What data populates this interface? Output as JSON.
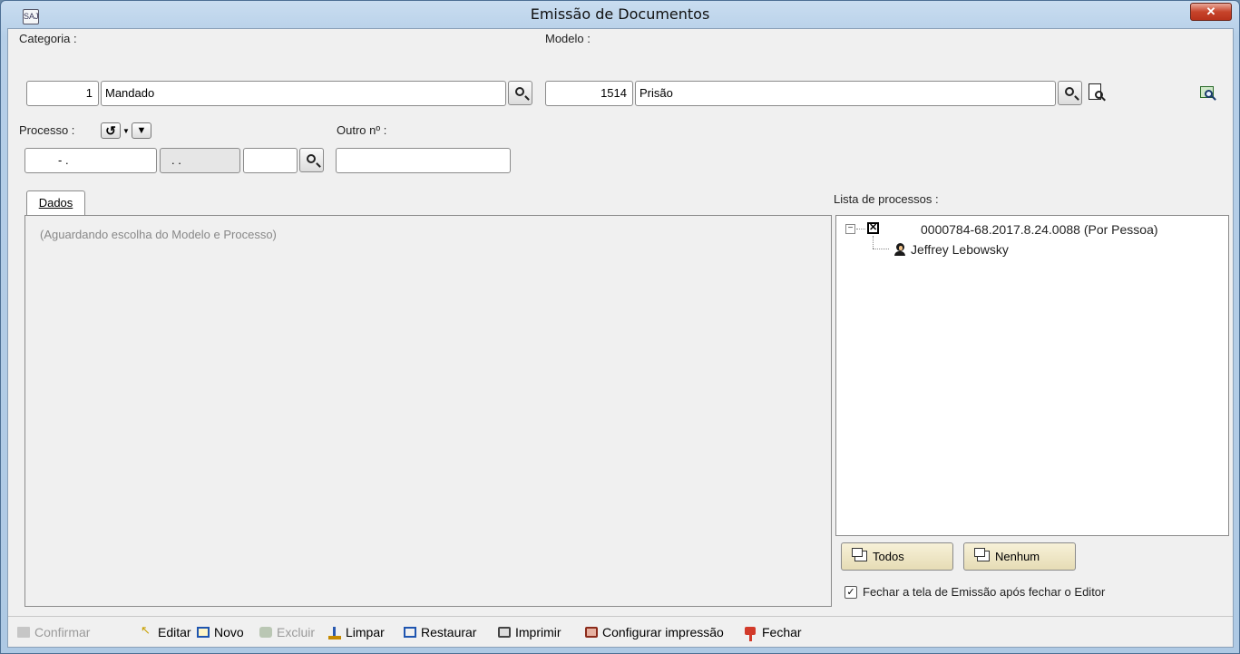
{
  "window": {
    "title": "Emissão de Documentos",
    "app_icon_text": "SAJ",
    "close_label": "✕"
  },
  "categoria": {
    "label": "Categoria :",
    "code": "1",
    "name": "Mandado"
  },
  "modelo": {
    "label": "Modelo :",
    "code": "1514",
    "name": "Prisão"
  },
  "processo": {
    "label": "Processo :",
    "part1": "- .",
    "part2": ". .",
    "part3": ""
  },
  "outro": {
    "label": "Outro nº :",
    "value": ""
  },
  "tabs": [
    {
      "label": "Dados"
    }
  ],
  "dados": {
    "placeholder": "(Aguardando escolha do Modelo e Processo)"
  },
  "lista": {
    "label": "Lista de processos :",
    "items": [
      {
        "text": "0000784-68.2017.8.24.0088 (Por Pessoa)",
        "checked": true,
        "children": [
          {
            "text": "Jeffrey Lebowsky",
            "icon": "person-icon"
          }
        ]
      }
    ]
  },
  "buttons": {
    "todos": "Todos",
    "nenhum": "Nenhum"
  },
  "fechar_option": {
    "label": "Fechar a tela de Emissão após fechar o Editor",
    "checked": true
  },
  "toolbar": {
    "items": [
      {
        "label": "Confirmar",
        "icon": "save-icon",
        "enabled": false
      },
      {
        "label": "Editar",
        "icon": "cursor-icon",
        "enabled": true
      },
      {
        "label": "Novo",
        "icon": "new-icon",
        "enabled": true
      },
      {
        "label": "Excluir",
        "icon": "delete-icon",
        "enabled": false
      },
      {
        "label": "Limpar",
        "icon": "broom-icon",
        "enabled": true
      },
      {
        "label": "Restaurar",
        "icon": "restore-icon",
        "enabled": true
      },
      {
        "label": "Imprimir",
        "icon": "printer-icon",
        "enabled": true
      },
      {
        "label": "Configurar impressão",
        "icon": "printer-setup-icon",
        "enabled": true
      },
      {
        "label": "Fechar",
        "icon": "exit-icon",
        "enabled": true
      }
    ]
  },
  "colors": {
    "title_bar": "#b6cfe8",
    "close": "#c7442b",
    "button": "#ece3c2"
  }
}
